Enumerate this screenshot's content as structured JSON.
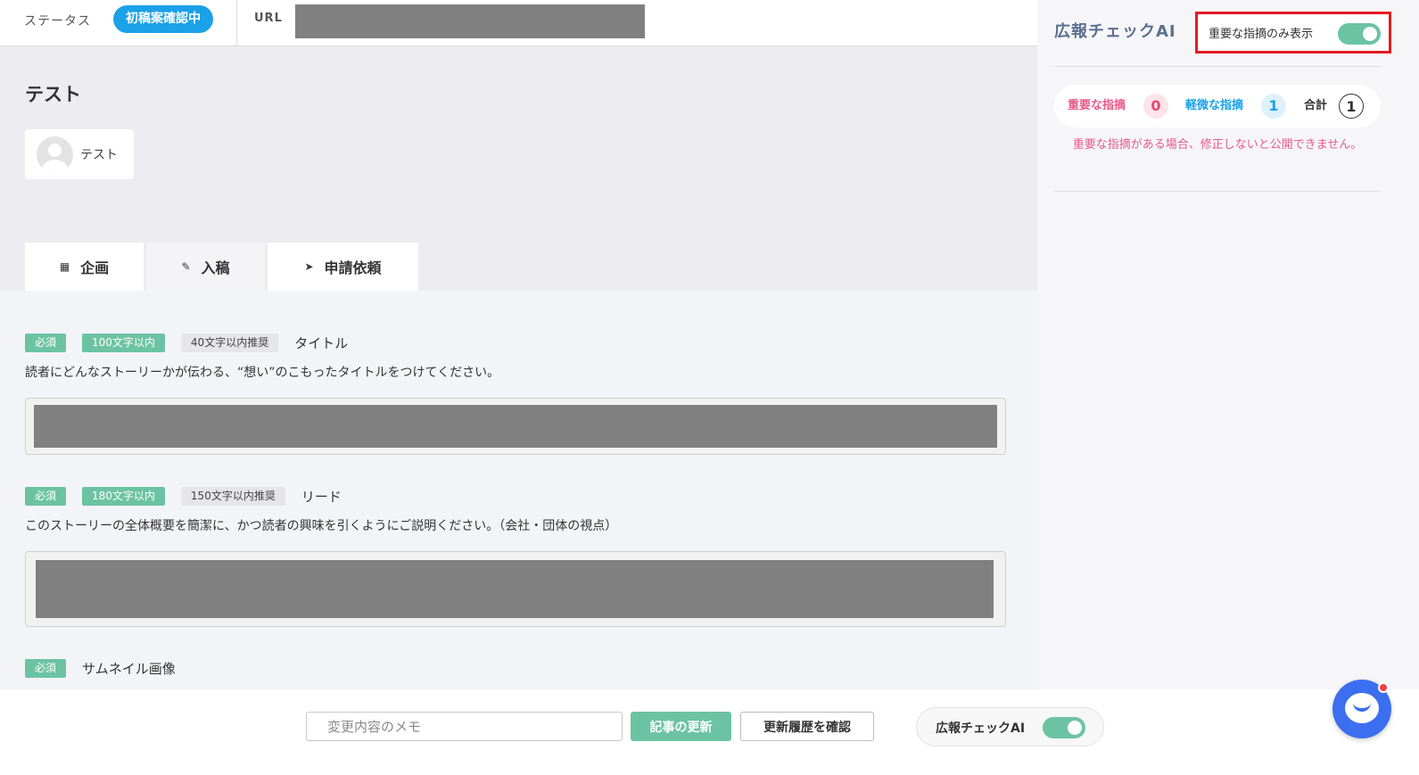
{
  "topbar": {
    "status_label": "ステータス",
    "status_value": "初稿案確認中",
    "url_label": "URL"
  },
  "article": {
    "title": "テスト",
    "author_name": "テスト"
  },
  "tabs": [
    {
      "label": "企画",
      "icon": "calendar-icon",
      "active": true
    },
    {
      "label": "入稿",
      "icon": "pencil-icon",
      "active": false
    },
    {
      "label": "申請依頼",
      "icon": "send-icon",
      "active": true
    }
  ],
  "fields": {
    "title": {
      "required": "必須",
      "limit": "100文字以内",
      "recommend": "40文字以内推奨",
      "label": "タイトル",
      "description": "読者にどんなストーリーかが伝わる、“想い”のこもったタイトルをつけてください。"
    },
    "lead": {
      "required": "必須",
      "limit": "180文字以内",
      "recommend": "150文字以内推奨",
      "label": "リード",
      "description": "このストーリーの全体概要を簡潔に、かつ読者の興味を引くようにご説明ください。（会社・団体の視点）"
    },
    "thumbnail": {
      "required": "必須",
      "label": "サムネイル画像"
    }
  },
  "bottombar": {
    "memo_placeholder": "変更内容のメモ",
    "update_button": "記事の更新",
    "history_button": "更新履歴を確認",
    "ai_toggle_label": "広報チェックAI",
    "ai_toggle_on": true
  },
  "panel": {
    "title": "広報チェックAI",
    "important_only_label": "重要な指摘のみ表示",
    "important_only_on": true,
    "summary": {
      "important_label": "重要な指摘",
      "important_count": "0",
      "minor_label": "軽微な指摘",
      "minor_count": "1",
      "total_label": "合計",
      "total_count": "1"
    },
    "warning": "重要な指摘がある場合、修正しないと公開できません。"
  },
  "colors": {
    "accent_green": "#6cc3a4",
    "status_blue": "#1aa1e8",
    "warning_pink": "#e85a88",
    "highlight_red": "#e31b23",
    "chat_blue": "#3c6ff0"
  }
}
